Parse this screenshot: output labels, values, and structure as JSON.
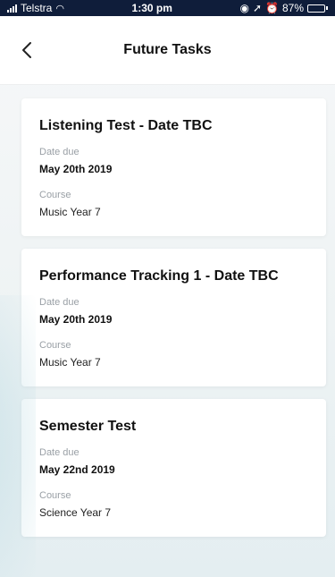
{
  "status_bar": {
    "carrier": "Telstra",
    "time": "1:30 pm",
    "battery_percent": "87%"
  },
  "nav": {
    "title": "Future Tasks"
  },
  "tasks": [
    {
      "title": "Listening Test - Date TBC",
      "date_label": "Date due",
      "date_value": "May 20th 2019",
      "course_label": "Course",
      "course_value": "Music Year 7"
    },
    {
      "title": "Performance Tracking 1 - Date TBC",
      "date_label": "Date due",
      "date_value": "May 20th 2019",
      "course_label": "Course",
      "course_value": "Music Year 7"
    },
    {
      "title": "Semester Test",
      "date_label": "Date due",
      "date_value": "May 22nd 2019",
      "course_label": "Course",
      "course_value": "Science Year 7"
    }
  ]
}
